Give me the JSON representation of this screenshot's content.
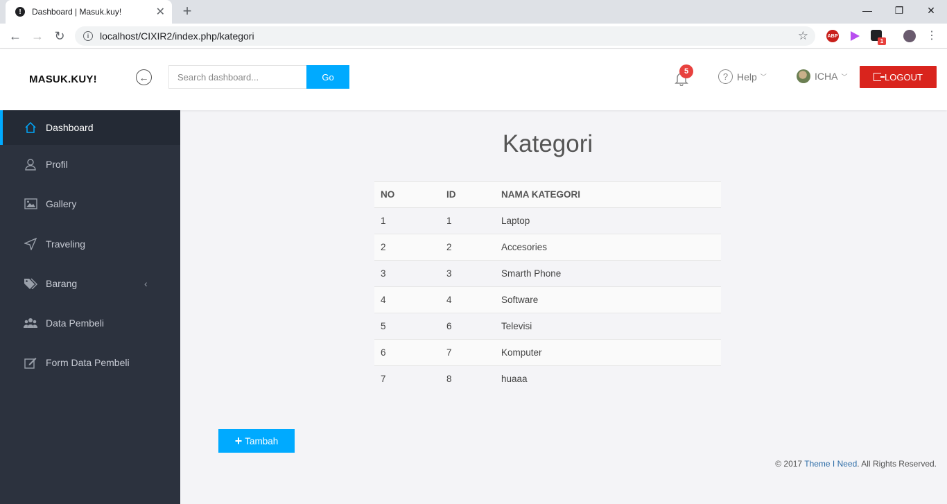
{
  "browser": {
    "tab_title": "Dashboard | Masuk.kuy!",
    "tab_icon": "!",
    "url": "localhost/CIXIR2/index.php/kategori",
    "ext_abp": "ABP",
    "ext_badge": "1"
  },
  "header": {
    "logo": "MASUK.KUY!",
    "search_placeholder": "Search dashboard...",
    "go_label": "Go",
    "notif_count": "5",
    "help_label": "Help",
    "user_name": "ICHA",
    "logout_label": "LOGOUT"
  },
  "sidebar": {
    "items": [
      {
        "label": "Dashboard"
      },
      {
        "label": "Profil"
      },
      {
        "label": "Gallery"
      },
      {
        "label": "Traveling"
      },
      {
        "label": "Barang"
      },
      {
        "label": "Data Pembeli"
      },
      {
        "label": "Form Data Pembeli"
      }
    ]
  },
  "main": {
    "title": "Kategori",
    "columns": [
      "NO",
      "ID",
      "NAMA KATEGORI"
    ],
    "rows": [
      [
        "1",
        "1",
        "Laptop"
      ],
      [
        "2",
        "2",
        "Accesories"
      ],
      [
        "3",
        "3",
        "Smarth Phone"
      ],
      [
        "4",
        "4",
        "Software"
      ],
      [
        "5",
        "6",
        "Televisi"
      ],
      [
        "6",
        "7",
        "Komputer"
      ],
      [
        "7",
        "8",
        "huaaa"
      ]
    ],
    "add_label": "Tambah"
  },
  "footer": {
    "prefix": "© 2017 ",
    "link": "Theme I Need",
    "suffix": ". All Rights Reserved."
  },
  "colors": {
    "accent": "#00aaff",
    "logout": "#d9241d",
    "sidebar": "#2c323e"
  }
}
